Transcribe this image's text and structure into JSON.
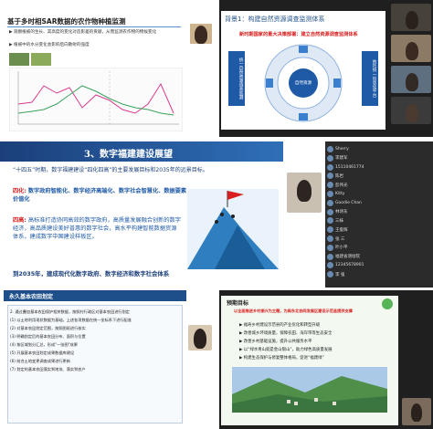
{
  "q1": {
    "title": "基于多时相SAR数据的农作物种植监测",
    "bullets": [
      "▶ 观察植被的生长、其高度的变化对造影差的贡献，从而监测农作物的物候变化",
      "▶ 植被中的水分变化会影响后向散射的强度"
    ],
    "chart_series_colors": [
      "#d93a8f",
      "#3aa35a"
    ]
  },
  "q2": {
    "title": "背景1：构建自然资源调查监测体系",
    "subtitle": "新时期国家的重大决策部署：建立自然资源调查监测体系",
    "left_box": "统一自然资源调查监测",
    "right_box": "依托统一信息化平台",
    "center": "自然资源"
  },
  "q3": {
    "title": "3、数字福建建设展望",
    "intro": "“十四五”时期，数字福建建设“四化四高”的主要发展目标和2035年的远景目标。",
    "sihua_label": "四化:",
    "sihua_text": "数字政府智能化、数字经济高端化、数字社会智慧化、数据要素价值化",
    "sigao_label": "四高:",
    "sigao_text": "高标准打造协同高效的数字政府，高质量发展融合创新的数字经济，高品质建设美好普惠的数字社会，高水平构建智能数据资源体系，建成数字中国建设样板区。",
    "goal_text": "到2035年，建成现代化数字政府、数字经济和数字社会体系",
    "participants": [
      "Sherry",
      "李建军",
      "15110461774",
      "陈岩",
      "彭伟光",
      "Kitty",
      "Goodie Chan",
      "林诗东",
      "三妹",
      "王俊辉",
      "张 三",
      "叶小平",
      "福建省测绘院",
      "12345678901",
      "李 强"
    ]
  },
  "q4": {
    "title": "永久基本农田划定",
    "body_lines": [
      "2. 通过叠加基本农田保护相关数据，按照村行政区对基本农田进行划定",
      "(1) 以土地利用现状数据为基础，上述各项数据在统一坐标系下进行配准",
      "(2) 对基本农田划定范围，按照图斑进行核实",
      "(3) 明确划定后的基本农田分布、面积与位置",
      "(4) 按区域划分汇总，形成\"一张图\"成果",
      "(5) 开展基本农田划定成果数据库建设",
      "(6) 结合土地变更调查成果进行更新",
      "(7) 划定的基本农田落实到地块、落实到农户"
    ]
  },
  "q5": {
    "title": "预期目标",
    "header_text": "以全面推进乡村振兴为主题，为闽东北协同发展区建设示范县提供支撑",
    "bullets": [
      "▶ 福寿乡村建设示范县的产业优化和转型升级",
      "▶ 改善城乡环境质量，保障农田、海岸带等生态安全",
      "▶ 改善乡村基础设施，提升公共服务水平",
      "▶ 以“绿水青山就是金山银山”，助力绿色高质量发展",
      "▶ 构建生态保护与修复整体格局，促进“福建绿”"
    ]
  },
  "colors": {
    "primary_blue": "#1f5aa6",
    "accent_red": "#d81e1e",
    "accent_green": "#57b557"
  }
}
